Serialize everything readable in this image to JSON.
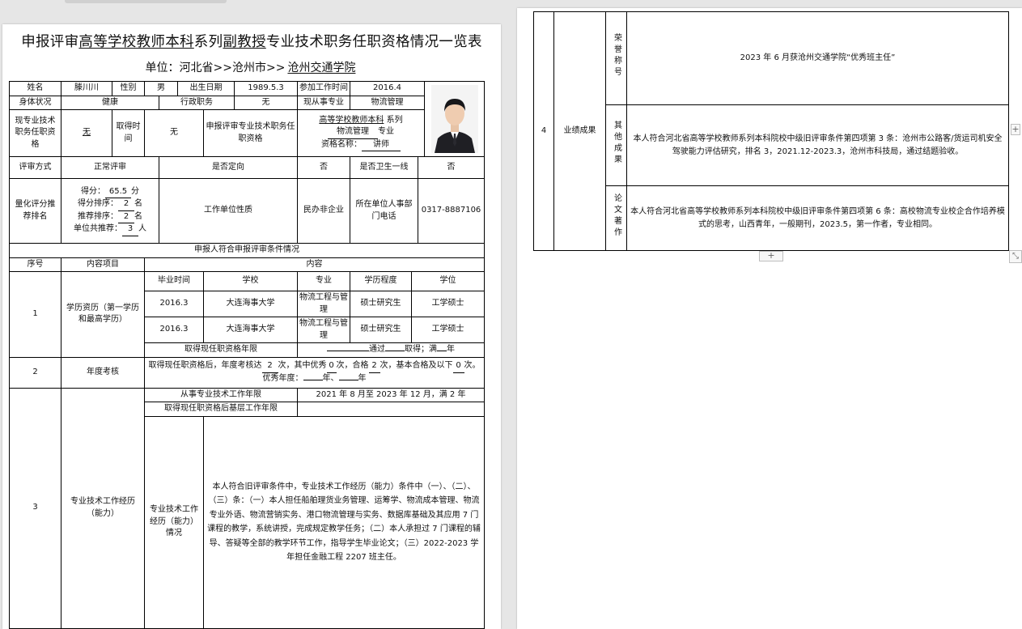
{
  "title": {
    "p1": "申报评审",
    "p2": "高等学校教师本科",
    "p3": "系列",
    "p4": "副教授",
    "p5": "专业技术职务任职资格情况一览表"
  },
  "unit": {
    "label": "单位：河北省>>沧州市>>",
    "value": "沧州交通学院"
  },
  "basic": {
    "name_label": "姓名",
    "name": "滕川川",
    "gender_label": "性别",
    "gender": "男",
    "birth_label": "出生日期",
    "birth": "1989.5.3",
    "work_start_label": "参加工作时间",
    "work_start": "2016.4",
    "health_label": "身体状况",
    "health": "健康",
    "admin_label": "行政职务",
    "admin": "无",
    "major_label": "现从事专业",
    "major": "物流管理",
    "cur_title_label": "现专业技术职务任职资格",
    "cur_title": "无",
    "obtain_label": "取得时间",
    "obtain": "无",
    "apply_label": "申报评审专业技术职务任职资格",
    "apply_series": "高等学校教师本科",
    "apply_series_suffix": "系列",
    "apply_major": "物流管理",
    "apply_major_suffix": "专业",
    "apply_name_label": "资格名称：",
    "apply_name": "讲师"
  },
  "review": {
    "method_label": "评审方式",
    "method": "正常评审",
    "directed_label": "是否定向",
    "directed": "否",
    "frontline_label": "是否卫生一线",
    "frontline": "否"
  },
  "score": {
    "label": "量化评分推荐排名",
    "score_label": "得分：",
    "score": "65.5",
    "score_unit": "分",
    "rank_label": "得分排序：",
    "rank": "2",
    "rank_unit": "名",
    "rec_label": "推荐排序：",
    "rec": "2",
    "rec_unit": "名",
    "total_label": "单位共推荐：",
    "total": "3",
    "total_unit": "人",
    "nature_label": "工作单位性质",
    "nature": "民办非企业",
    "phone_label": "所在单位人事部门电话",
    "phone": "0317-8887106"
  },
  "section_header": "申报人符合申报评审条件情况",
  "table_header": {
    "no": "序号",
    "item": "内容项目",
    "content": "内容"
  },
  "edu": {
    "no": "1",
    "label": "学历资历（第一学历和最高学历）",
    "headers": [
      "毕业时间",
      "学校",
      "专业",
      "学历程度",
      "学位"
    ],
    "rows": [
      [
        "2016.3",
        "大连海事大学",
        "物流工程与管理",
        "硕士研究生",
        "工学硕士"
      ],
      [
        "2016.3",
        "大连海事大学",
        "物流工程与管理",
        "硕士研究生",
        "工学硕士"
      ]
    ],
    "years_label": "取得现任职资格年限",
    "years_pass": "通过",
    "years_get": "取得；满",
    "years_unit": "年"
  },
  "annual": {
    "no": "2",
    "label": "年度考核",
    "t1": "取得现任职资格后，年度考核达",
    "count": "2",
    "t2": "次，其中优秀",
    "excellent": "0",
    "t3": "次，合格",
    "pass": "2",
    "t4": "次，基本合格及以下",
    "basic": "0",
    "t5": "次。优秀年度：",
    "y1": "年、",
    "y2": "年"
  },
  "work": {
    "no": "3",
    "label": "专业技术工作经历（能力）",
    "years_label": "从事专业技术工作年限",
    "years_value": "2021 年 8 月至 2023 年 12 月，满 2 年",
    "grassroots_label": "取得现任职资格后基层工作年限",
    "grassroots_value": "",
    "detail_label": "专业技术工作经历（能力）情况",
    "detail": "本人符合旧评审条件中，专业技术工作经历（能力）条件中（一）、（二）、（三）条：（一）本人担任船舶理货业务管理、运筹学、物流成本管理、物流专业外语、物流营销实务、港口物流管理与实务、数据库基础及其应用 7 门课程的教学，系统讲授，完成规定教学任务；（二）本人承担过 7 门课程的辅导、答疑等全部的教学环节工作，指导学生毕业论文；（三）2022-2023 学年担任金融工程 2207 班主任。"
  },
  "achievement": {
    "no": "4",
    "label": "业绩成果",
    "honor_label": "荣誉称号",
    "honor": "2023 年 6 月获沧州交通学院“优秀班主任”",
    "other_label": "其他成果",
    "other": "本人符合河北省高等学校教师系列本科院校中级旧评审条件第四项第 3 条：沧州市公路客/货运司机安全驾驶能力评估研究，排名 3，2021.12-2023.3，沧州市科技局，通过结题验收。",
    "paper_label": "论文著作",
    "paper": "本人符合河北省高等学校教师系列本科院校中级旧评审条件第四项第 6 条：高校物流专业校企合作培养模式的思考，山西青年，一般期刊，2023.5，第一作者，专业相同。"
  },
  "ui": {
    "add_symbol": "+",
    "resize_symbol": "⤡"
  },
  "colors": {
    "canvas": "#e6e6e6",
    "page": "#ffffff",
    "border": "#000000"
  }
}
